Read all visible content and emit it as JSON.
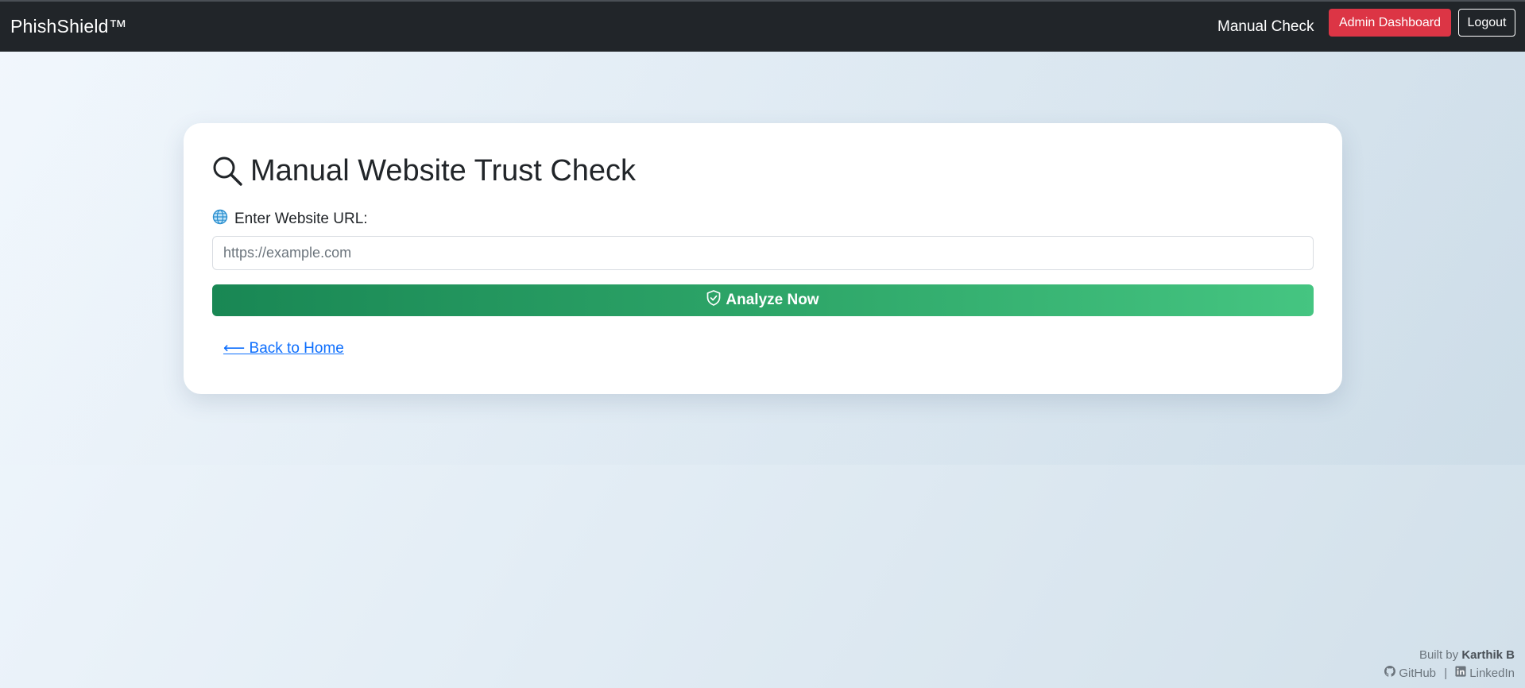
{
  "navbar": {
    "brand": "PhishShield™",
    "manual_check_link": "Manual Check",
    "admin_button": "Admin Dashboard",
    "logout_button": "Logout"
  },
  "card": {
    "title_icon": "search-icon",
    "title": "Manual Website Trust Check",
    "url_label_icon": "globe-icon",
    "url_label": "Enter Website URL:",
    "url_input_value": "",
    "url_input_placeholder": "https://example.com",
    "analyze_icon": "shield-check-icon",
    "analyze_button": "Analyze Now",
    "back_link": "⟵ Back to Home"
  },
  "footer": {
    "built_by_prefix": "Built by",
    "author": "Karthik B",
    "github_icon": "github-icon",
    "github_label": "GitHub",
    "separator": "|",
    "linkedin_icon": "linkedin-icon",
    "linkedin_label": "LinkedIn"
  },
  "colors": {
    "navbar_bg": "#212529",
    "admin_button_bg": "#dc3545",
    "analyze_gradient_start": "#198754",
    "analyze_gradient_end": "#45c581",
    "link": "#0d6efd"
  }
}
